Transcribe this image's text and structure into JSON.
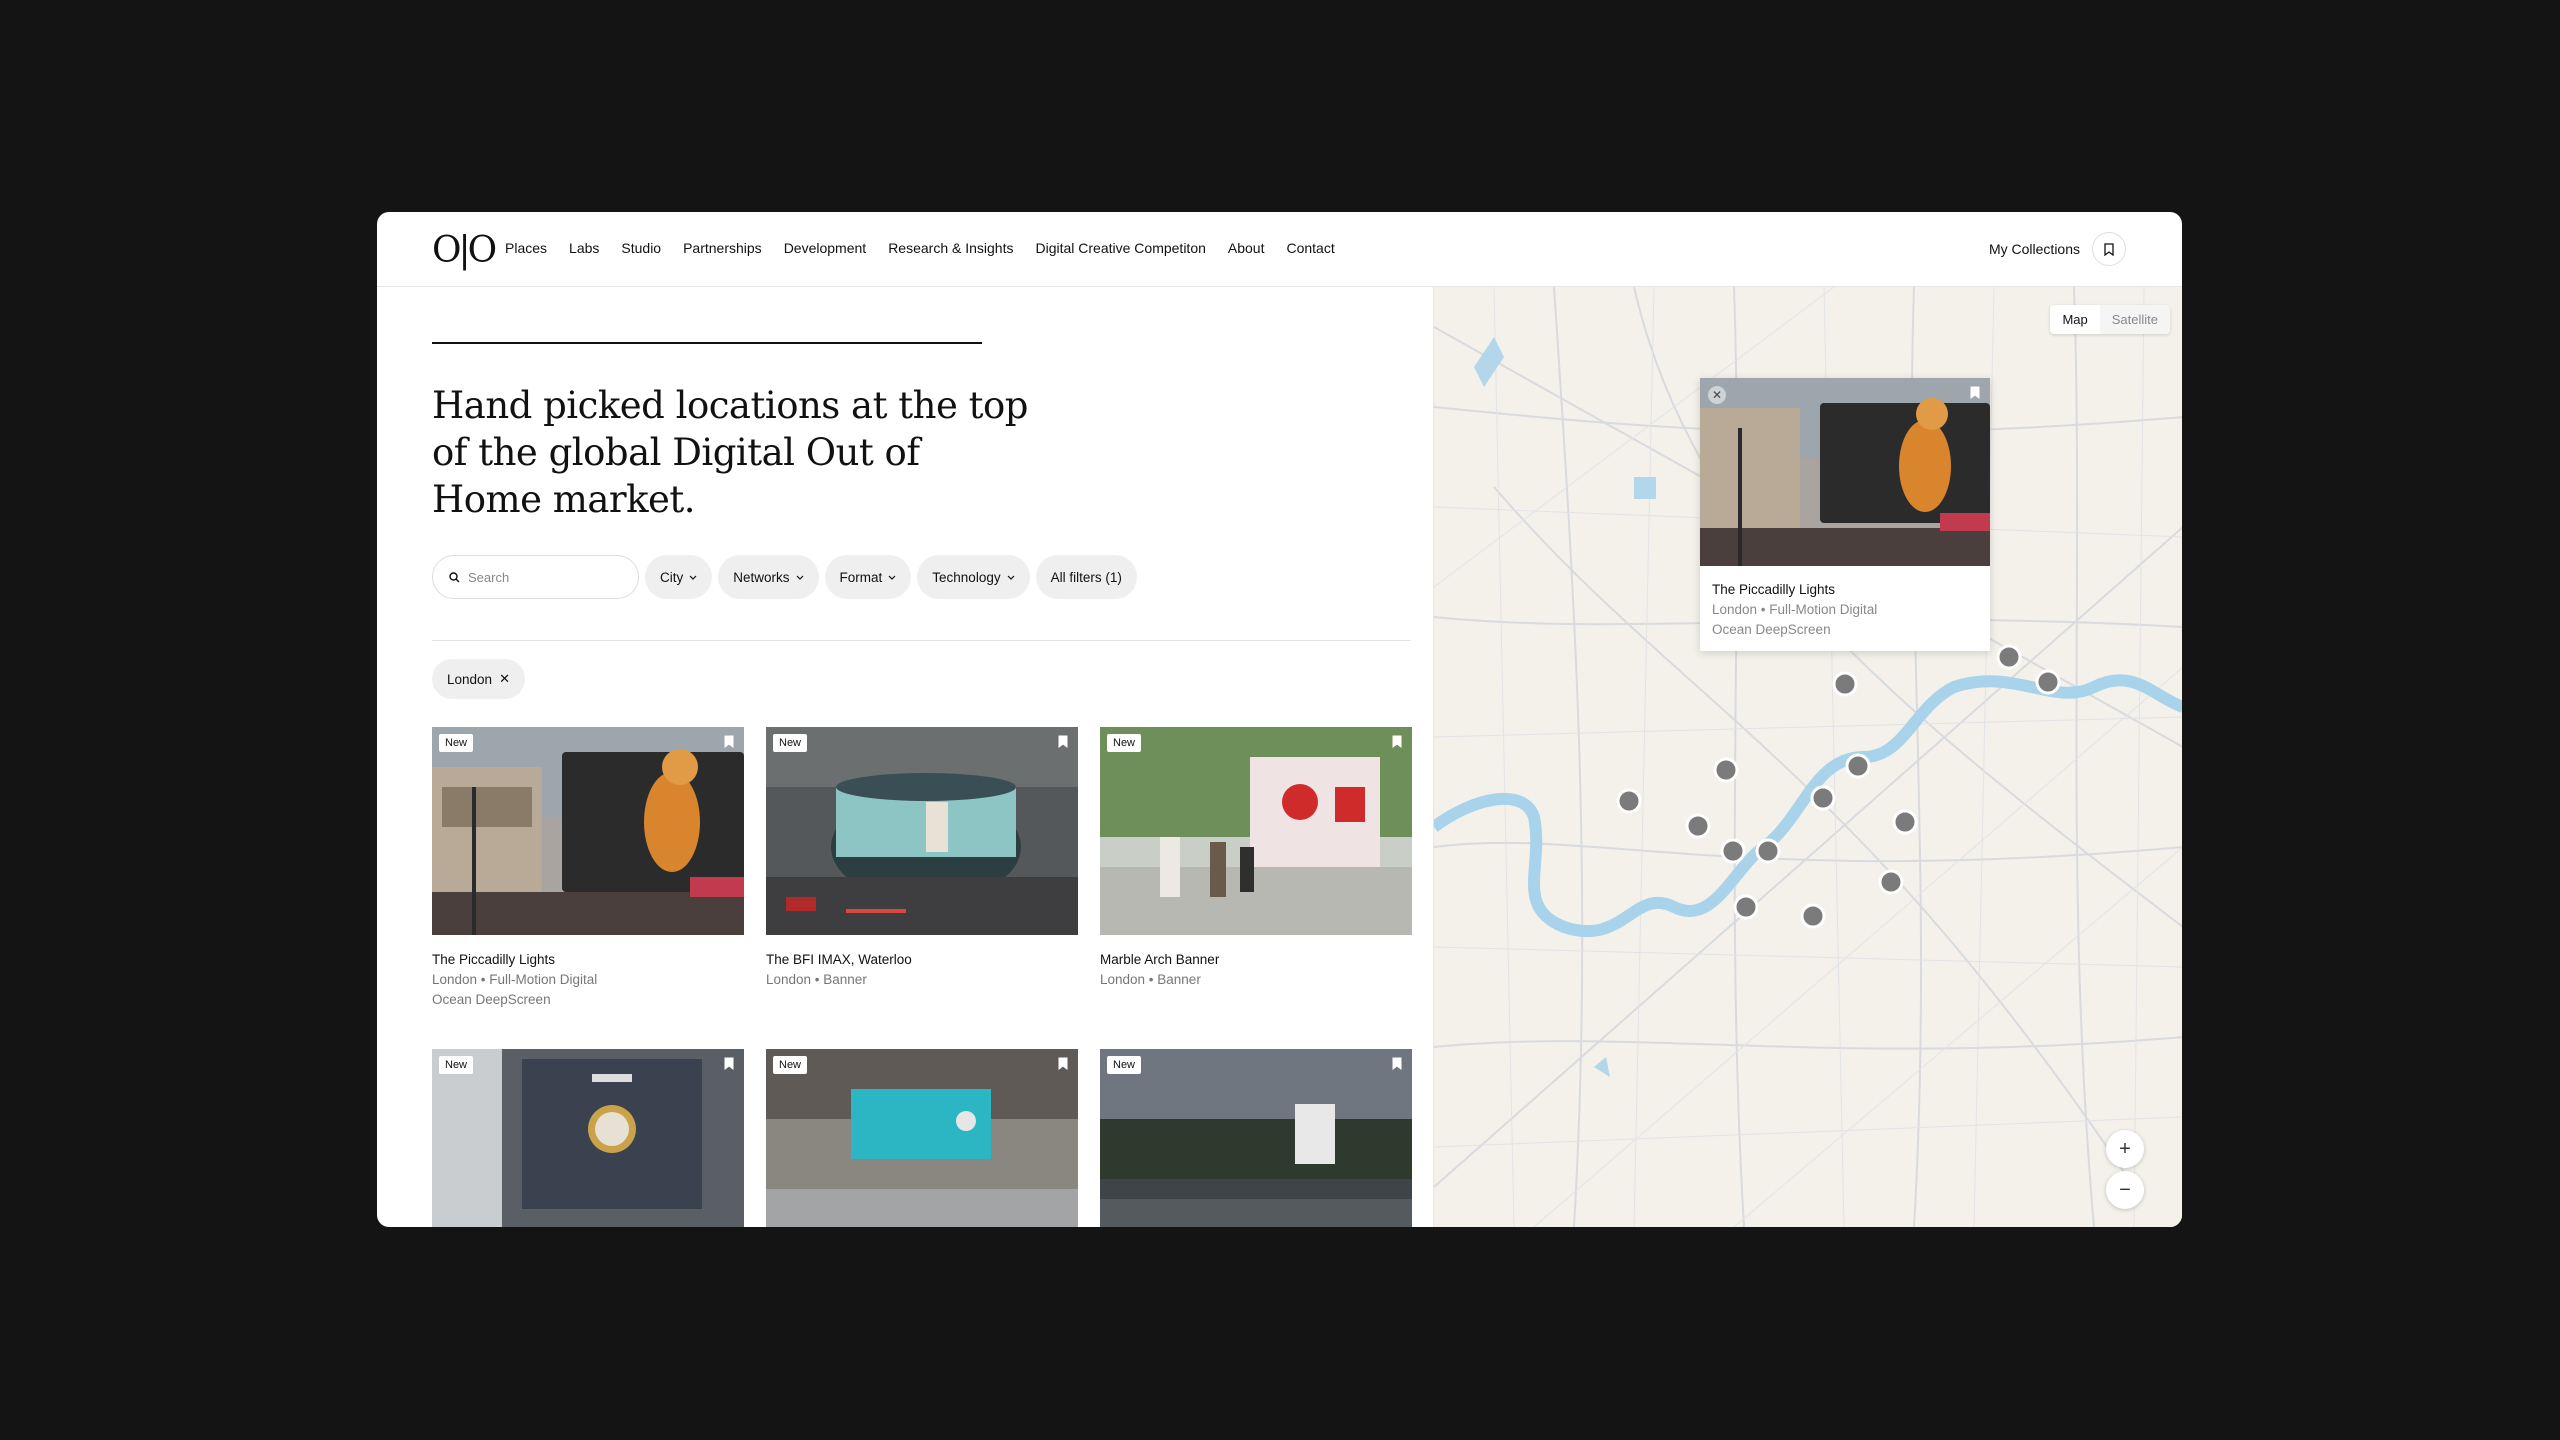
{
  "header": {
    "logo": "O|O",
    "nav": [
      "Places",
      "Labs",
      "Studio",
      "Partnerships",
      "Development",
      "Research & Insights",
      "Digital Creative Competiton",
      "About",
      "Contact"
    ],
    "collections_label": "My Collections"
  },
  "hero": {
    "headline": "Hand picked locations at the top of the global Digital Out of Home market."
  },
  "filters": {
    "search_placeholder": "Search",
    "city": "City",
    "networks": "Networks",
    "format": "Format",
    "technology": "Technology",
    "all_filters": "All filters (1)"
  },
  "active_tag": "London",
  "cards": [
    {
      "badge": "New",
      "title": "The Piccadilly Lights",
      "sub1": "London • Full-Motion Digital",
      "sub2": "Ocean DeepScreen"
    },
    {
      "badge": "New",
      "title": "The BFI IMAX, Waterloo",
      "sub1": "London • Banner",
      "sub2": ""
    },
    {
      "badge": "New",
      "title": "Marble Arch Banner",
      "sub1": "London • Banner",
      "sub2": ""
    },
    {
      "badge": "New",
      "title": "",
      "sub1": "",
      "sub2": ""
    },
    {
      "badge": "New",
      "title": "",
      "sub1": "",
      "sub2": ""
    },
    {
      "badge": "New",
      "title": "",
      "sub1": "",
      "sub2": ""
    }
  ],
  "map": {
    "toggle_map": "Map",
    "toggle_satellite": "Satellite",
    "popup": {
      "title": "The Piccadilly Lights",
      "sub1": "London • Full-Motion Digital",
      "sub2": "Ocean DeepScreen"
    },
    "zoom_in": "+",
    "zoom_out": "−"
  }
}
